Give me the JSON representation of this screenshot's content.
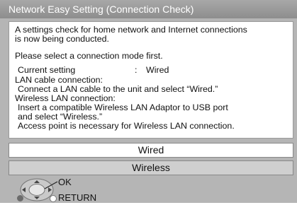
{
  "window": {
    "title": "Network Easy Setting (Connection Check)"
  },
  "message": {
    "intro_line1": "A settings check for home network and Internet connections",
    "intro_line2": "is now being conducted.",
    "prompt": "Please select a connection mode first.",
    "current_label": "Current setting",
    "current_sep": ":",
    "current_value": "Wired",
    "lan_heading": "LAN cable connection:",
    "lan_text": "Connect a LAN cable to the unit and select “Wired.”",
    "wlan_heading": "Wireless LAN connection:",
    "wlan_text1": "Insert a compatible Wireless LAN Adaptor to USB port",
    "wlan_text2": "and select “Wireless.”",
    "wlan_text3": "Access point is necessary for Wireless LAN connection."
  },
  "options": [
    {
      "label": "Wired",
      "selected": true
    },
    {
      "label": "Wireless",
      "selected": false
    }
  ],
  "hints": {
    "ok_label": "OK",
    "return_label": "RETURN"
  },
  "colors": {
    "background": "#b5b5b5",
    "title_bar": "#9a9a9a",
    "panel": "#ffffff",
    "selected_option": "#ffffff",
    "unselected_option": "#cfcfcf"
  }
}
